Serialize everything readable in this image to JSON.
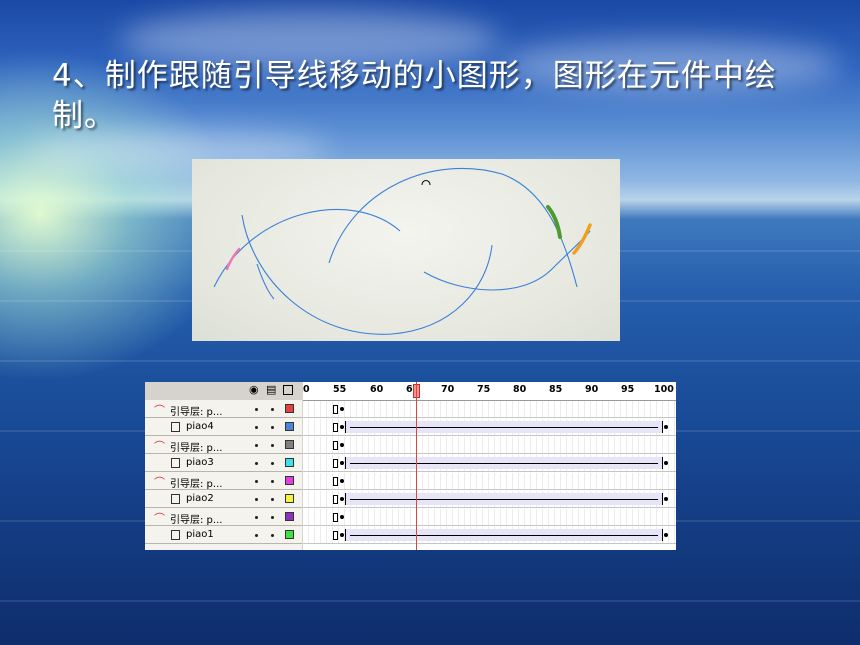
{
  "slide": {
    "title_line1": "4、制作跟随引导线移动的小图形，图形在元件中绘",
    "title_line2": "制。"
  },
  "timeline": {
    "ruler_labels": [
      "0",
      "55",
      "60",
      "65",
      "70",
      "75",
      "80",
      "85",
      "90",
      "95",
      "100"
    ],
    "current_frame": 66,
    "layers": [
      {
        "name": "引导层: p...",
        "type": "guide",
        "color": "#e84040"
      },
      {
        "name": "piao4",
        "type": "layer",
        "color": "#4a86d8"
      },
      {
        "name": "引导层: p...",
        "type": "guide",
        "color": "#808080"
      },
      {
        "name": "piao3",
        "type": "layer",
        "color": "#40e0e8"
      },
      {
        "name": "引导层: p...",
        "type": "guide",
        "color": "#e040e0"
      },
      {
        "name": "piao2",
        "type": "layer",
        "color": "#f4f440"
      },
      {
        "name": "引导层: p...",
        "type": "guide",
        "color": "#9030c0"
      },
      {
        "name": "piao1",
        "type": "layer",
        "color": "#40e040"
      }
    ]
  },
  "colors": {
    "curve": "#3a7fd9",
    "stroke_green": "#4e9a2c",
    "stroke_orange": "#f0a020",
    "stroke_pink": "#e87ab8"
  },
  "icons": [
    "eye-icon",
    "lock-icon",
    "outline-icon",
    "guide-layer-icon",
    "layer-icon"
  ]
}
